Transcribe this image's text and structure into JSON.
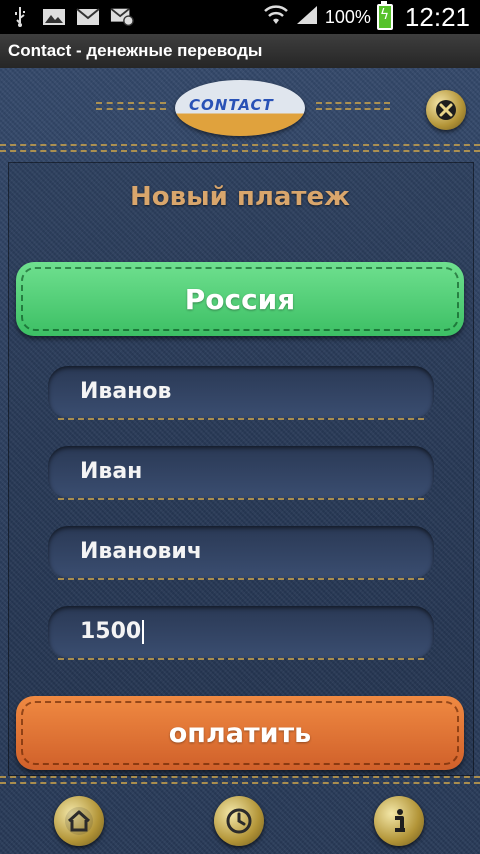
{
  "status_bar": {
    "battery_percent": "100%",
    "time": "12:21",
    "icons": [
      "usb-icon",
      "image-icon",
      "mail-icon",
      "mail-settings-icon",
      "wifi-icon",
      "signal-icon",
      "battery-icon"
    ]
  },
  "title_bar": {
    "title": "Contact - денежные переводы"
  },
  "header": {
    "logo_text": "CONTACT",
    "close_icon": "close-icon"
  },
  "form": {
    "heading": "Новый платеж",
    "country_button": "Россия",
    "last_name": "Иванов",
    "first_name": "Иван",
    "middle_name": "Иванович",
    "amount": "1500",
    "pay_button": "оплатить"
  },
  "bottom_nav": {
    "icons": [
      "home-icon",
      "history-icon",
      "info-icon"
    ]
  },
  "colors": {
    "denim": "#30456a",
    "green": "#52d07a",
    "orange": "#e2743a",
    "gold": "#c9a24c",
    "heading": "#d9a66c"
  }
}
